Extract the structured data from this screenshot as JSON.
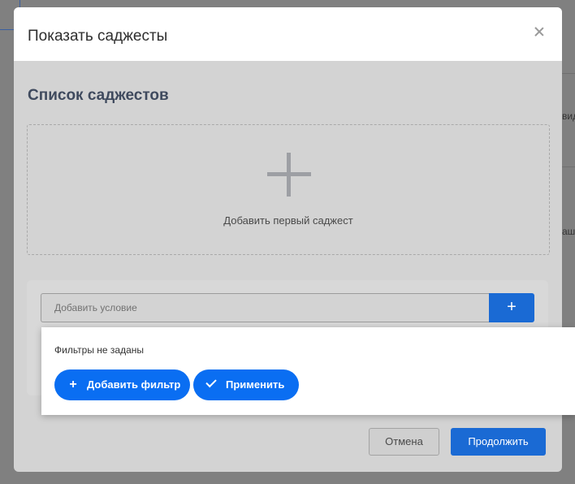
{
  "dialog": {
    "title": "Показать саджесты",
    "section_title": "Список саджестов",
    "dropzone_label": "Добавить первый саджест",
    "condition": {
      "placeholder": "Добавить условие",
      "add_symbol": "+"
    },
    "cancel_label": "Отмена",
    "continue_label": "Продолжить"
  },
  "popover": {
    "empty_text": "Фильтры не заданы",
    "add_filter_label": "Добавить фильтр",
    "add_filter_symbol": "+",
    "apply_label": "Применить"
  },
  "background": {
    "frag_1": "вид",
    "frag_2": "аш"
  },
  "colors": {
    "primary": "#1a6ad4",
    "pill_primary": "#0a6ef2"
  }
}
